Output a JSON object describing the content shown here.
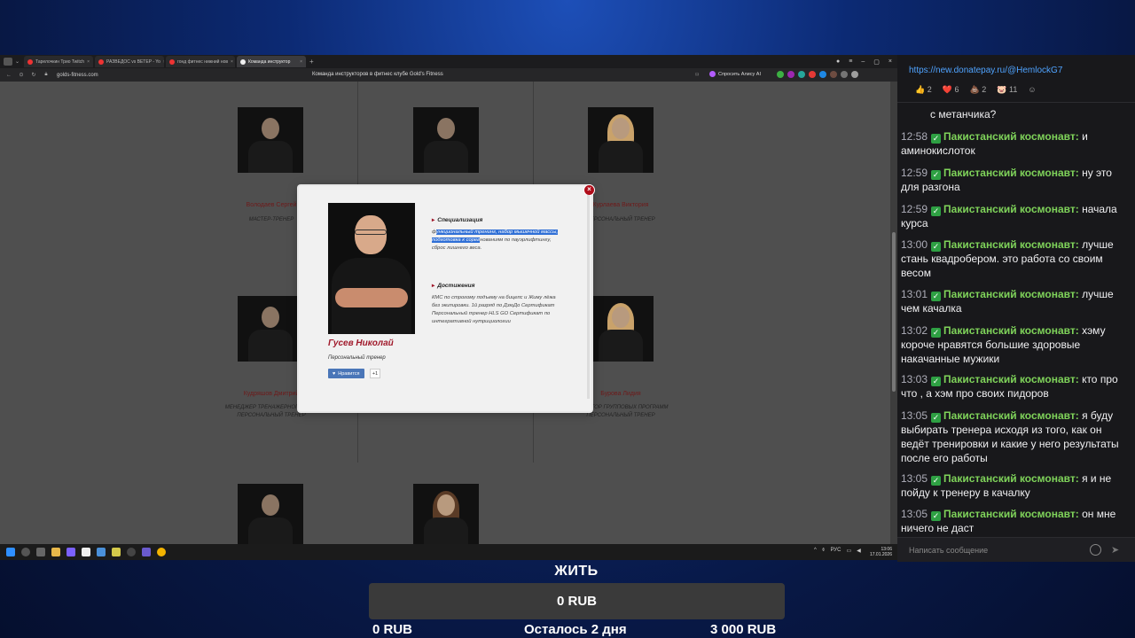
{
  "browser": {
    "tabs": [
      {
        "label": "Тарелочкин Трио Twitch",
        "color": "#e53935"
      },
      {
        "label": "РАЗВЕДОС vs BETEP - Yo",
        "color": "#e53935"
      },
      {
        "label": "гонд фитнес нижний нов",
        "color": "#e53935"
      },
      {
        "label": "Команда инструктор",
        "color": "#f0f0f0"
      }
    ],
    "url": "golds-fitness.com",
    "page_title": "Команда инструкторов в фитнес клубе Gold's Fitness",
    "alice_label": "Спросить Алису AI"
  },
  "trainers": [
    {
      "name": "Володаев Сергей",
      "role": "МАСТЕР-ТРЕНЕР"
    },
    {
      "name": "Курлаева Виктория",
      "role": "ПЕРСОНАЛЬНЫЙ ТРЕНЕР"
    },
    {
      "name": "Кудряшов Дмитрий",
      "role": "МЕНЕДЖЕР ТРЕНАЖЕРНОГО ЗАЛА ПЕРСОНАЛЬНЫЙ ТРЕНЕР"
    },
    {
      "name": "Бурова Лидия",
      "role": "ДИРЕКТОР ГРУППОВЫХ ПРОГРАММ ПЕРСОНАЛЬНЫЙ ТРЕНЕР"
    }
  ],
  "modal": {
    "close": "×",
    "name": "Гусев Николай",
    "role": "Персональный тренер",
    "like_label": "Нравится",
    "like_count": "+1",
    "spec_title": "Специализация",
    "spec_pre": "ф",
    "spec_highlight": "ункциональный тренинг, набор мышечной массы, подготовка к сорев",
    "spec_post": "нованиям по пауэрлифтингу, сброс лишнего веса.",
    "ach_title": "Достижения",
    "ach_text": "КМС по строгому подъему на бицепс и Жиму лёжа без экипировки. 1й разряд по ДзюДо Сертификат Персональный тренер HLS GO Сертификат по интегративной нутрициологии"
  },
  "taskbar": {
    "lang": "РУС",
    "time": "13:06",
    "date": "17.01.2026"
  },
  "chat": {
    "link": "https://new.donatepay.ru/@HemlockG7",
    "reactions": [
      {
        "emoji": "👍",
        "count": "2"
      },
      {
        "emoji": "❤️",
        "count": "6"
      },
      {
        "emoji": "💩",
        "count": "2"
      },
      {
        "emoji": "🐷",
        "count": "11"
      }
    ],
    "first_line": "с метанчика?",
    "user": "Пакистанский космонавт:",
    "messages": [
      {
        "time": "12:58",
        "text": "и аминокислоток"
      },
      {
        "time": "12:59",
        "text": "ну это для разгона"
      },
      {
        "time": "12:59",
        "text": "начала курса"
      },
      {
        "time": "13:00",
        "text": "лучше стань квадробером. это работа со своим весом"
      },
      {
        "time": "13:01",
        "text": "лучше чем качалка"
      },
      {
        "time": "13:02",
        "text": "хэму короче нравятся большие здоровые накачанные мужики"
      },
      {
        "time": "13:03",
        "text": "кто про что , а хэм про своих пидоров"
      },
      {
        "time": "13:05",
        "text": "я буду выбирать тренера исходя из того, как он ведёт тренировки и какие у него результаты после его работы"
      },
      {
        "time": "13:05",
        "text": "я и не пойду к тренеру в качалку"
      },
      {
        "time": "13:05",
        "text": "он мне ничего не даст"
      }
    ],
    "input_placeholder": "Написать сообщение"
  },
  "donation": {
    "title": "ЖИТЬ",
    "collected": "0 RUB",
    "min": "0 RUB",
    "remaining": "Осталось 2 дня",
    "goal": "3 000 RUB"
  }
}
